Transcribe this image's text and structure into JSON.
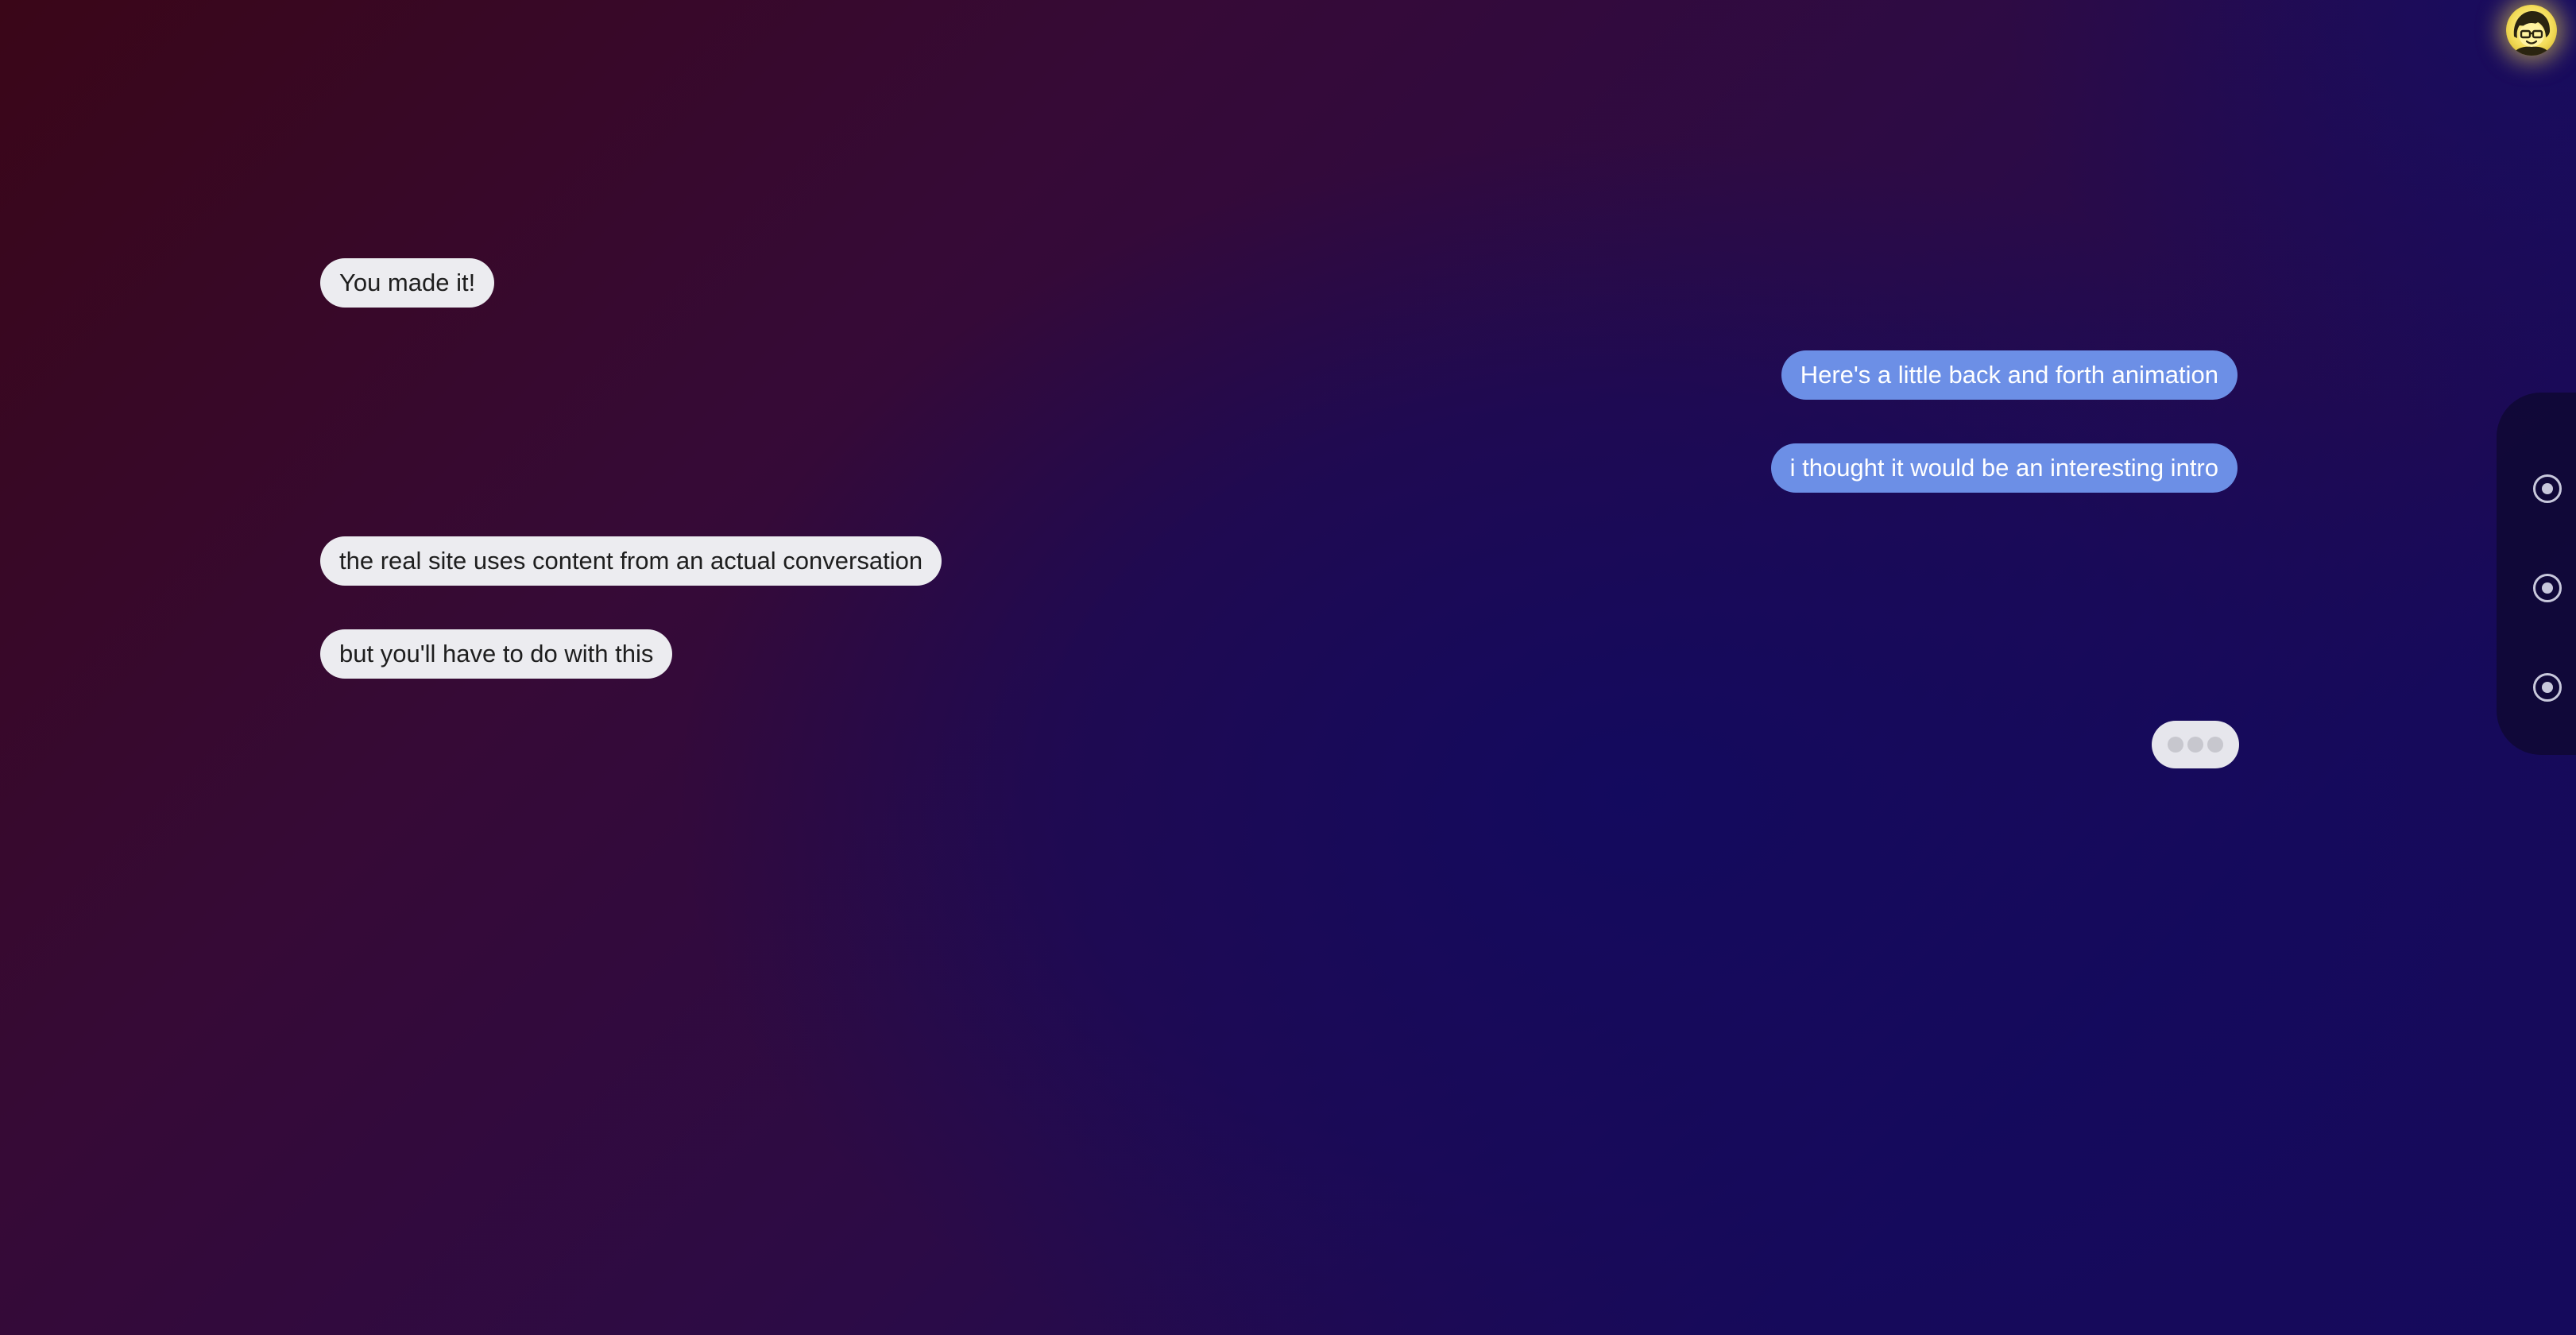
{
  "conversation": {
    "messages": [
      {
        "from": "received",
        "text": "You made it!"
      },
      {
        "from": "sent",
        "text": "Here's a little back and forth animation"
      },
      {
        "from": "sent",
        "text": "i thought it would be an interesting intro"
      },
      {
        "from": "received",
        "text": "the real site uses content from an actual conversation"
      },
      {
        "from": "received",
        "text": "but you'll have to do with this"
      }
    ],
    "typing_indicator": {
      "dots": 3
    }
  },
  "avatar": {
    "icon": "yellow-face-icon"
  },
  "side_nav": {
    "items": [
      {
        "icon": "radio-dot-icon"
      },
      {
        "icon": "radio-dot-icon"
      },
      {
        "icon": "radio-dot-icon"
      }
    ]
  },
  "colors": {
    "received_bubble": "#ececf0",
    "sent_bubble": "#6c8fe6",
    "background_top_left": "#3a0618",
    "background_bottom_right": "#150a5c",
    "avatar_glow": "#f4dd5a"
  }
}
